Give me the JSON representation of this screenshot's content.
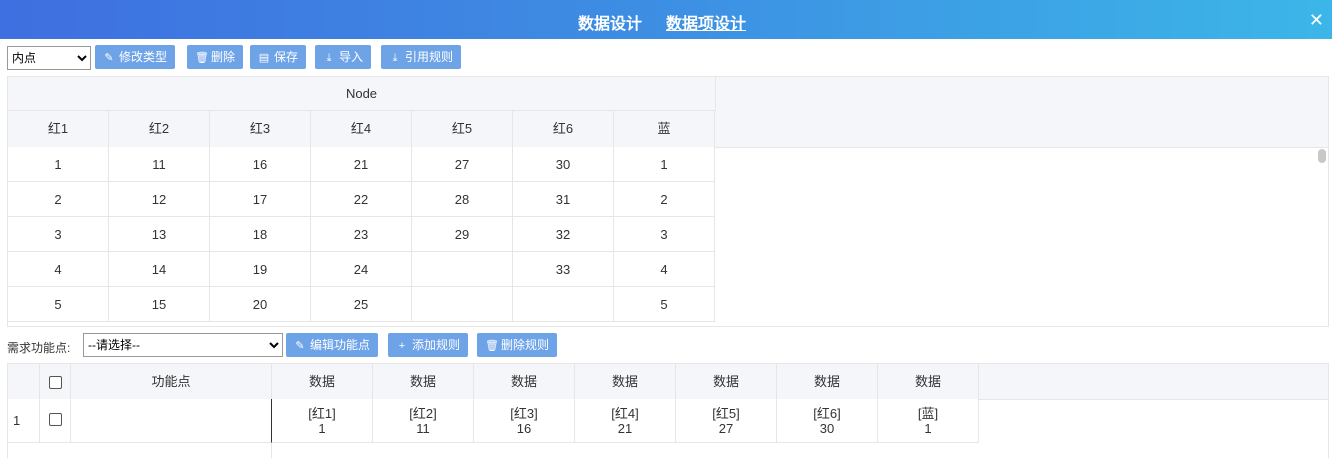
{
  "header": {
    "title": "数据设计",
    "subtitle": "数据项设计",
    "close": "✕"
  },
  "toolbar1": {
    "select_value": "内点",
    "buttons": [
      {
        "label": "修改类型",
        "icon": "edit-icon"
      },
      {
        "label": "删除",
        "icon": "trash-icon"
      },
      {
        "label": "保存",
        "icon": "save-icon"
      },
      {
        "label": "导入",
        "icon": "import-icon"
      },
      {
        "label": "引用规则",
        "icon": "import-icon"
      }
    ]
  },
  "grid1": {
    "group_header": "Node",
    "columns": [
      "红1",
      "红2",
      "红3",
      "红4",
      "红5",
      "红6",
      "蓝"
    ],
    "rows": [
      [
        "1",
        "11",
        "16",
        "21",
        "27",
        "30",
        "1"
      ],
      [
        "2",
        "12",
        "17",
        "22",
        "28",
        "31",
        "2"
      ],
      [
        "3",
        "13",
        "18",
        "23",
        "29",
        "32",
        "3"
      ],
      [
        "4",
        "14",
        "19",
        "24",
        "",
        "33",
        "4"
      ],
      [
        "5",
        "15",
        "20",
        "25",
        "",
        "",
        "5"
      ]
    ]
  },
  "toolbar2": {
    "label": "需求功能点:",
    "select_value": "--请选择--",
    "buttons": [
      {
        "label": "编辑功能点",
        "icon": "edit-icon"
      },
      {
        "label": "添加规则",
        "icon": "plus-icon"
      },
      {
        "label": "删除规则",
        "icon": "trash-icon"
      }
    ]
  },
  "grid2": {
    "columns": [
      "功能点",
      "数据",
      "数据",
      "数据",
      "数据",
      "数据",
      "数据",
      "数据"
    ],
    "rows": [
      {
        "index": "1",
        "func": "",
        "cells": [
          {
            "name": "[红1]",
            "value": "1"
          },
          {
            "name": "[红2]",
            "value": "11"
          },
          {
            "name": "[红3]",
            "value": "16"
          },
          {
            "name": "[红4]",
            "value": "21"
          },
          {
            "name": "[红5]",
            "value": "27"
          },
          {
            "name": "[红6]",
            "value": "30"
          },
          {
            "name": "[蓝]",
            "value": "1"
          }
        ]
      }
    ]
  }
}
